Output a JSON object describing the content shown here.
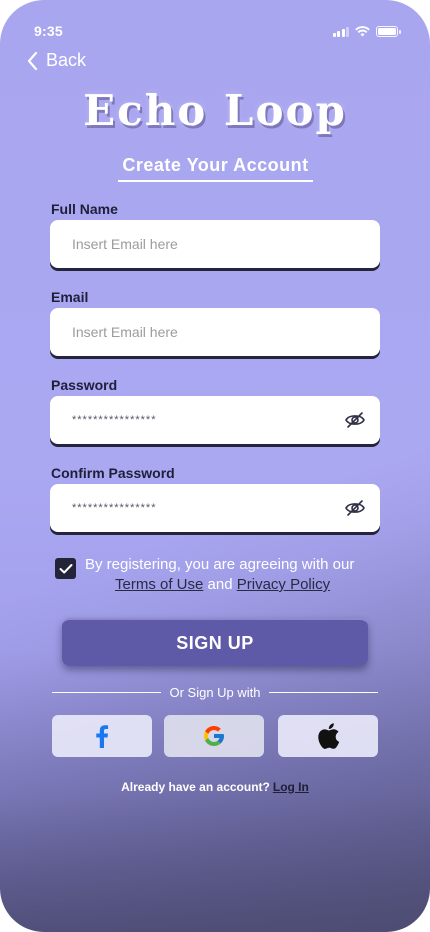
{
  "status_bar": {
    "time": "9:35",
    "icons": [
      "signal-icon",
      "wifi-icon",
      "battery-icon"
    ]
  },
  "nav": {
    "back_label": "Back"
  },
  "app": {
    "logo_text": "Echo Loop",
    "subtitle": "Create Your Account"
  },
  "form": {
    "full_name": {
      "label": "Full Name",
      "placeholder": "Insert Email here"
    },
    "email": {
      "label": "Email",
      "placeholder": "Insert Email here"
    },
    "password": {
      "label": "Password",
      "value": "****************"
    },
    "confirm_password": {
      "label": "Confirm Password",
      "value": "****************"
    }
  },
  "terms": {
    "checked": true,
    "text": "By registering, you are agreeing with our",
    "terms_link": "Terms of Use",
    "and": "and",
    "privacy_link": "Privacy Policy"
  },
  "signup_button": "SIGN UP",
  "divider_text": "Or Sign Up with",
  "social": [
    "facebook-icon",
    "google-icon",
    "apple-icon"
  ],
  "login": {
    "prompt": "Already have an account?",
    "link": "Log In"
  },
  "colors": {
    "background": "#a9a6f0",
    "button": "#5f5aa8",
    "dark_text": "#1f1f3a",
    "facebook": "#1877f2"
  }
}
